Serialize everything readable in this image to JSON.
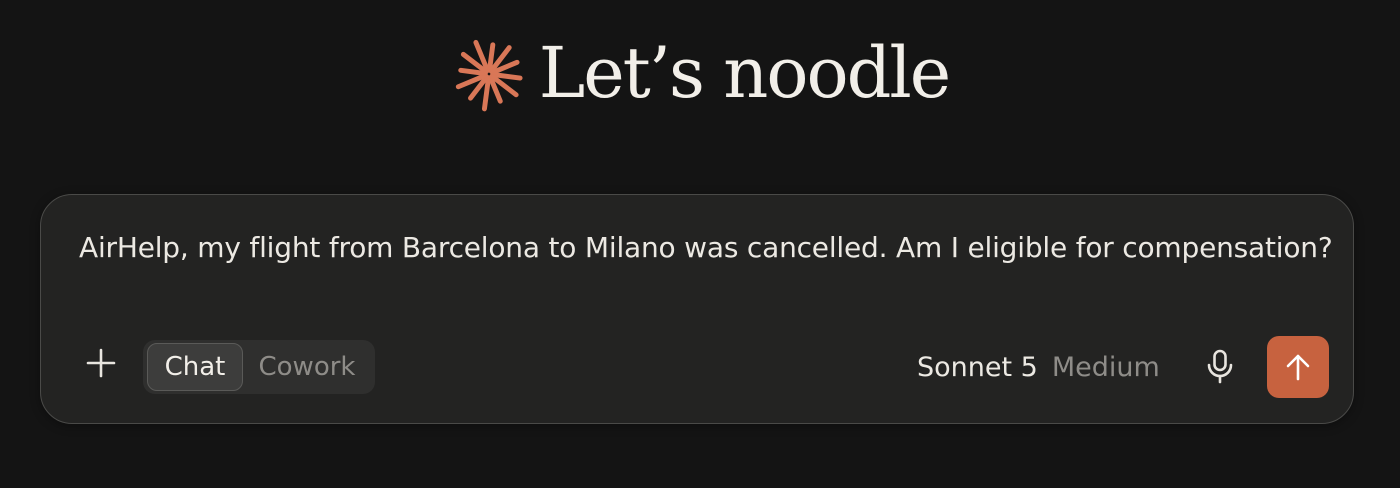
{
  "header": {
    "greeting": "Let’s noodle",
    "logo_icon": "asterisk-burst-icon",
    "logo_color": "#d97757"
  },
  "composer": {
    "prompt_text": "AirHelp, my flight from Barcelona to Milano was cancelled. Am I eligible for compensation?",
    "add_icon": "plus-icon",
    "mode_tabs": [
      {
        "label": "Chat",
        "active": true
      },
      {
        "label": "Cowork",
        "active": false
      }
    ],
    "model": {
      "name": "Sonnet 5",
      "effort": "Medium"
    },
    "mic_icon": "microphone-icon",
    "send_icon": "arrow-up-icon",
    "send_color": "#c7623f"
  }
}
